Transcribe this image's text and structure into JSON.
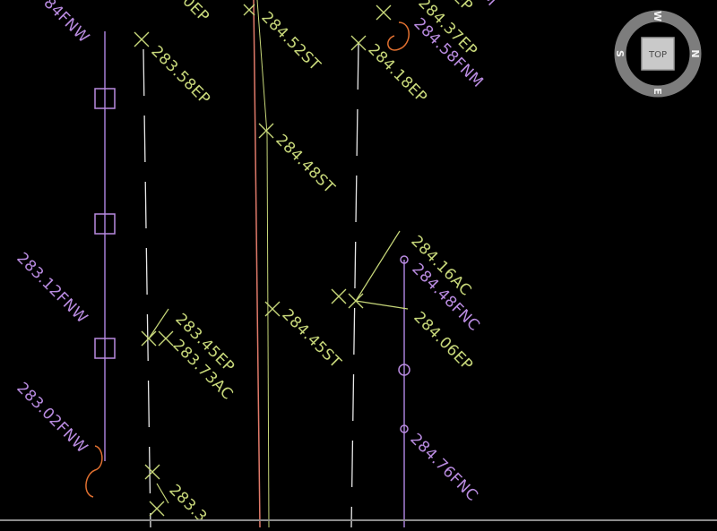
{
  "colors": {
    "background": "#000000",
    "yellow_green": "#c8d87a",
    "purple": "#b98be0",
    "orange": "#e07030",
    "red_line": "#e07a6a",
    "white_dash": "#e8e8e8",
    "viewcube_ring": "#7d7d7d",
    "viewcube_face": "#c9c9c9"
  },
  "viewcube": {
    "top_label": "TOP",
    "north": "N",
    "south": "S",
    "east": "E",
    "west": "W"
  },
  "labels": {
    "fnw_top": "84FNW",
    "ep_top_left": "0EP",
    "ep_top_right": "EP",
    "fnm_top_right": "M",
    "st_1": "284.52ST",
    "ep_1": "283.58EP",
    "ep_2": "284.37EP",
    "fnm_1": "284.58FNM",
    "ep_3": "284.18EP",
    "st_2": "284.48ST",
    "fnw_1": "283.12FNW",
    "ac_1": "284.16AC",
    "fnc_1": "284.48FNC",
    "ep_4": "284.06EP",
    "ep_5": "283.45EP",
    "ac_2": "283.73AC",
    "st_3": "284.45ST",
    "fnw_2": "283.02FNW",
    "fnc_2": "284.76FNC",
    "partial_bottom": "283.3"
  }
}
